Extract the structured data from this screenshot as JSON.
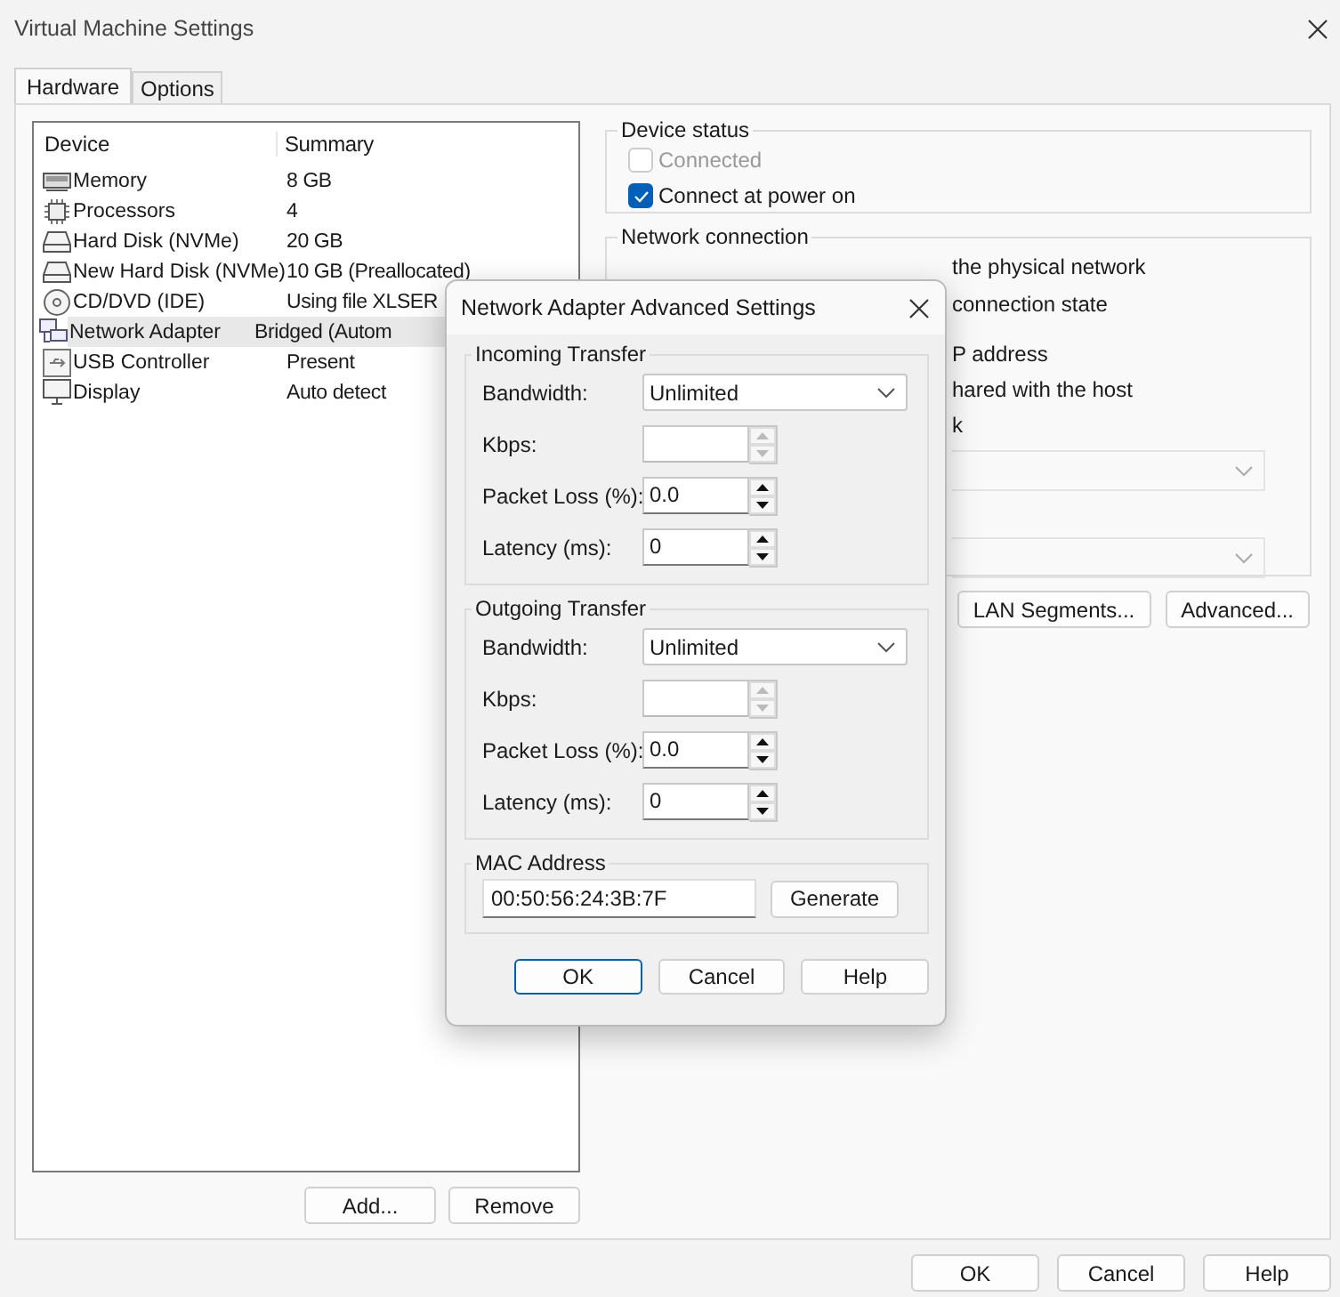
{
  "window": {
    "title": "Virtual Machine Settings"
  },
  "tabs": [
    {
      "label": "Hardware",
      "selected": true
    },
    {
      "label": "Options",
      "selected": false
    }
  ],
  "device_table": {
    "columns": [
      "Device",
      "Summary"
    ],
    "rows": [
      {
        "kind": "memory",
        "device": "Memory",
        "summary": "8 GB",
        "selected": false
      },
      {
        "kind": "cpu",
        "device": "Processors",
        "summary": "4",
        "selected": false
      },
      {
        "kind": "disk",
        "device": "Hard Disk (NVMe)",
        "summary": "20 GB",
        "selected": false
      },
      {
        "kind": "disk",
        "device": "New Hard Disk (NVMe)",
        "summary": "10 GB (Preallocated)",
        "selected": false
      },
      {
        "kind": "cd",
        "device": "CD/DVD (IDE)",
        "summary": "Using file XLSER",
        "selected": false
      },
      {
        "kind": "network",
        "device": "Network Adapter",
        "summary": "Bridged (Autom",
        "selected": true
      },
      {
        "kind": "usb",
        "device": "USB Controller",
        "summary": "Present",
        "selected": false
      },
      {
        "kind": "display",
        "device": "Display",
        "summary": "Auto detect",
        "selected": false
      }
    ]
  },
  "list_buttons": [
    "Add...",
    "Remove"
  ],
  "device_status": {
    "title": "Device status",
    "options": [
      {
        "label": "Connected",
        "checked": false,
        "disabled": true
      },
      {
        "label": "Connect at power on",
        "checked": true,
        "disabled": false
      }
    ]
  },
  "network_connection": {
    "title": "Network connection",
    "texts": [
      "the physical network",
      "connection state",
      "P address",
      "hared with the host",
      "k"
    ]
  },
  "network_buttons": [
    "LAN Segments...",
    "Advanced..."
  ],
  "footer_buttons": [
    "OK",
    "Cancel",
    "Help"
  ],
  "modal": {
    "title": "Network Adapter Advanced Settings",
    "groups": [
      {
        "title": "Incoming Transfer",
        "fields": [
          {
            "kind": "dropdown",
            "label": "Bandwidth:",
            "value": "Unlimited",
            "disabled": false
          },
          {
            "kind": "spinner",
            "label": "Kbps:",
            "disabled": true
          },
          {
            "kind": "spinner",
            "label": "Packet Loss (%):",
            "value": "0.0",
            "disabled": false
          },
          {
            "kind": "spinner",
            "label": "Latency (ms):",
            "value": "0",
            "disabled": false
          }
        ]
      },
      {
        "title": "Outgoing Transfer",
        "fields": [
          {
            "kind": "dropdown",
            "label": "Bandwidth:",
            "value": "Unlimited",
            "disabled": false
          },
          {
            "kind": "spinner",
            "label": "Kbps:",
            "disabled": true
          },
          {
            "kind": "spinner",
            "label": "Packet Loss (%):",
            "value": "0.0",
            "disabled": false
          },
          {
            "kind": "spinner",
            "label": "Latency (ms):",
            "value": "0",
            "disabled": false
          }
        ]
      }
    ],
    "mac": {
      "title": "MAC Address",
      "value": "00:50:56:24:3B:7F",
      "button": "Generate"
    },
    "buttons": [
      {
        "label": "OK",
        "default": true
      },
      {
        "label": "Cancel",
        "default": false
      },
      {
        "label": "Help",
        "default": false
      }
    ]
  }
}
